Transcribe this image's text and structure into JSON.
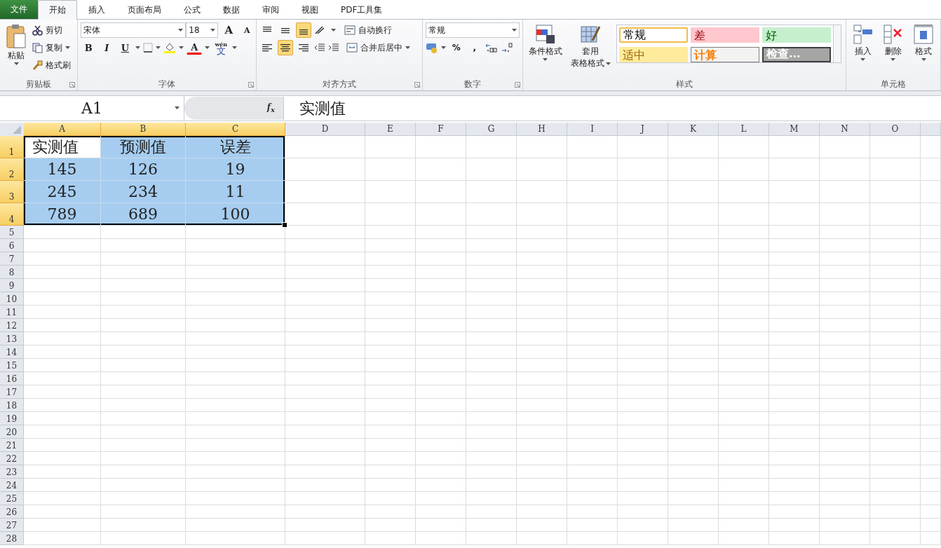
{
  "tabs": [
    {
      "label": "文件",
      "kind": "file",
      "selected": false
    },
    {
      "label": "开始",
      "kind": "tab",
      "selected": true
    },
    {
      "label": "插入",
      "kind": "tab",
      "selected": false
    },
    {
      "label": "页面布局",
      "kind": "tab",
      "selected": false
    },
    {
      "label": "公式",
      "kind": "tab",
      "selected": false
    },
    {
      "label": "数据",
      "kind": "tab",
      "selected": false
    },
    {
      "label": "审阅",
      "kind": "tab",
      "selected": false
    },
    {
      "label": "视图",
      "kind": "tab",
      "selected": false
    },
    {
      "label": "PDF工具集",
      "kind": "tab",
      "selected": false
    }
  ],
  "ribbon": {
    "groups": [
      {
        "kind": "clipboard",
        "label": "剪贴板",
        "launcher": true,
        "paste": "粘贴",
        "items": [
          "剪切",
          "复制",
          "格式刷"
        ]
      },
      {
        "kind": "font",
        "label": "字体",
        "launcher": true,
        "font_name": "宋体",
        "font_size": "18",
        "grow": "A",
        "shrink": "A",
        "styles": [
          "B",
          "I",
          "U"
        ],
        "font_color": "A",
        "phonetic_top": "wén",
        "phonetic": "文"
      },
      {
        "kind": "alignment",
        "label": "对齐方式",
        "launcher": true,
        "vertical": [
          {
            "selected": false
          },
          {
            "selected": false
          },
          {
            "selected": true
          }
        ],
        "horizontal": [
          {
            "selected": false
          },
          {
            "selected": true
          },
          {
            "selected": false
          }
        ],
        "wrap": "自动换行",
        "merge": "合并后居中"
      },
      {
        "kind": "number",
        "label": "数字",
        "launcher": true,
        "format": "常规",
        "symbols": [
          "%",
          ","
        ]
      },
      {
        "kind": "styles",
        "label": "样式",
        "conditional": "条件格式",
        "table_format": [
          "套用",
          "表格格式"
        ],
        "cell_styles": [
          {
            "label": "常规",
            "kind": "normal",
            "selected": true
          },
          {
            "label": "差",
            "kind": "bad",
            "selected": false
          },
          {
            "label": "好",
            "kind": "good",
            "selected": false
          },
          {
            "label": "适中",
            "kind": "neutral",
            "selected": false
          },
          {
            "label": "计算",
            "kind": "calc",
            "selected": false
          },
          {
            "label": "检查...",
            "kind": "check",
            "selected": false
          }
        ]
      },
      {
        "kind": "cells",
        "label": "单元格",
        "buttons": [
          "插入",
          "删除",
          "格式"
        ]
      }
    ]
  },
  "formula_bar": {
    "name_box": "A1",
    "fx": "f$_{x}$",
    "value": "实测值"
  },
  "sheet": {
    "columns": [
      {
        "label": "A",
        "selected": true
      },
      {
        "label": "B",
        "selected": true
      },
      {
        "label": "C",
        "selected": true
      },
      {
        "label": "D",
        "selected": false
      },
      {
        "label": "E",
        "selected": false
      },
      {
        "label": "F",
        "selected": false
      },
      {
        "label": "G",
        "selected": false
      },
      {
        "label": "H",
        "selected": false
      },
      {
        "label": "I",
        "selected": false
      },
      {
        "label": "J",
        "selected": false
      },
      {
        "label": "K",
        "selected": false
      },
      {
        "label": "L",
        "selected": false
      },
      {
        "label": "M",
        "selected": false
      },
      {
        "label": "N",
        "selected": false
      },
      {
        "label": "O",
        "selected": false
      }
    ],
    "rows": [
      {
        "header": "1",
        "selected": true,
        "cells": [
          {
            "text": "实测值",
            "selected": true,
            "active": true
          },
          {
            "text": "预测值",
            "selected": true,
            "active": false
          },
          {
            "text": "误差",
            "selected": true,
            "active": false
          }
        ]
      },
      {
        "header": "2",
        "selected": true,
        "cells": [
          {
            "text": "145",
            "selected": true,
            "active": false
          },
          {
            "text": "126",
            "selected": true,
            "active": false
          },
          {
            "text": "19",
            "selected": true,
            "active": false
          }
        ]
      },
      {
        "header": "3",
        "selected": true,
        "cells": [
          {
            "text": "245",
            "selected": true,
            "active": false
          },
          {
            "text": "234",
            "selected": true,
            "active": false
          },
          {
            "text": "11",
            "selected": true,
            "active": false
          }
        ]
      },
      {
        "header": "4",
        "selected": true,
        "cells": [
          {
            "text": "789",
            "selected": true,
            "active": false
          },
          {
            "text": "689",
            "selected": true,
            "active": false
          },
          {
            "text": "100",
            "selected": true,
            "active": false
          }
        ]
      },
      {
        "header": "5",
        "selected": false
      },
      {
        "header": "6",
        "selected": false
      },
      {
        "header": "7",
        "selected": false
      },
      {
        "header": "8",
        "selected": false
      },
      {
        "header": "9",
        "selected": false
      },
      {
        "header": "10",
        "selected": false
      },
      {
        "header": "11",
        "selected": false
      },
      {
        "header": "12",
        "selected": false
      },
      {
        "header": "13",
        "selected": false
      },
      {
        "header": "14",
        "selected": false
      },
      {
        "header": "15",
        "selected": false
      },
      {
        "header": "16",
        "selected": false
      },
      {
        "header": "17",
        "selected": false
      },
      {
        "header": "18",
        "selected": false
      },
      {
        "header": "19",
        "selected": false
      },
      {
        "header": "20",
        "selected": false
      },
      {
        "header": "21",
        "selected": false
      },
      {
        "header": "22",
        "selected": false
      },
      {
        "header": "23",
        "selected": false
      },
      {
        "header": "24",
        "selected": false
      },
      {
        "header": "25",
        "selected": false
      },
      {
        "header": "26",
        "selected": false
      },
      {
        "header": "27",
        "selected": false
      },
      {
        "header": "28",
        "selected": false
      }
    ]
  }
}
